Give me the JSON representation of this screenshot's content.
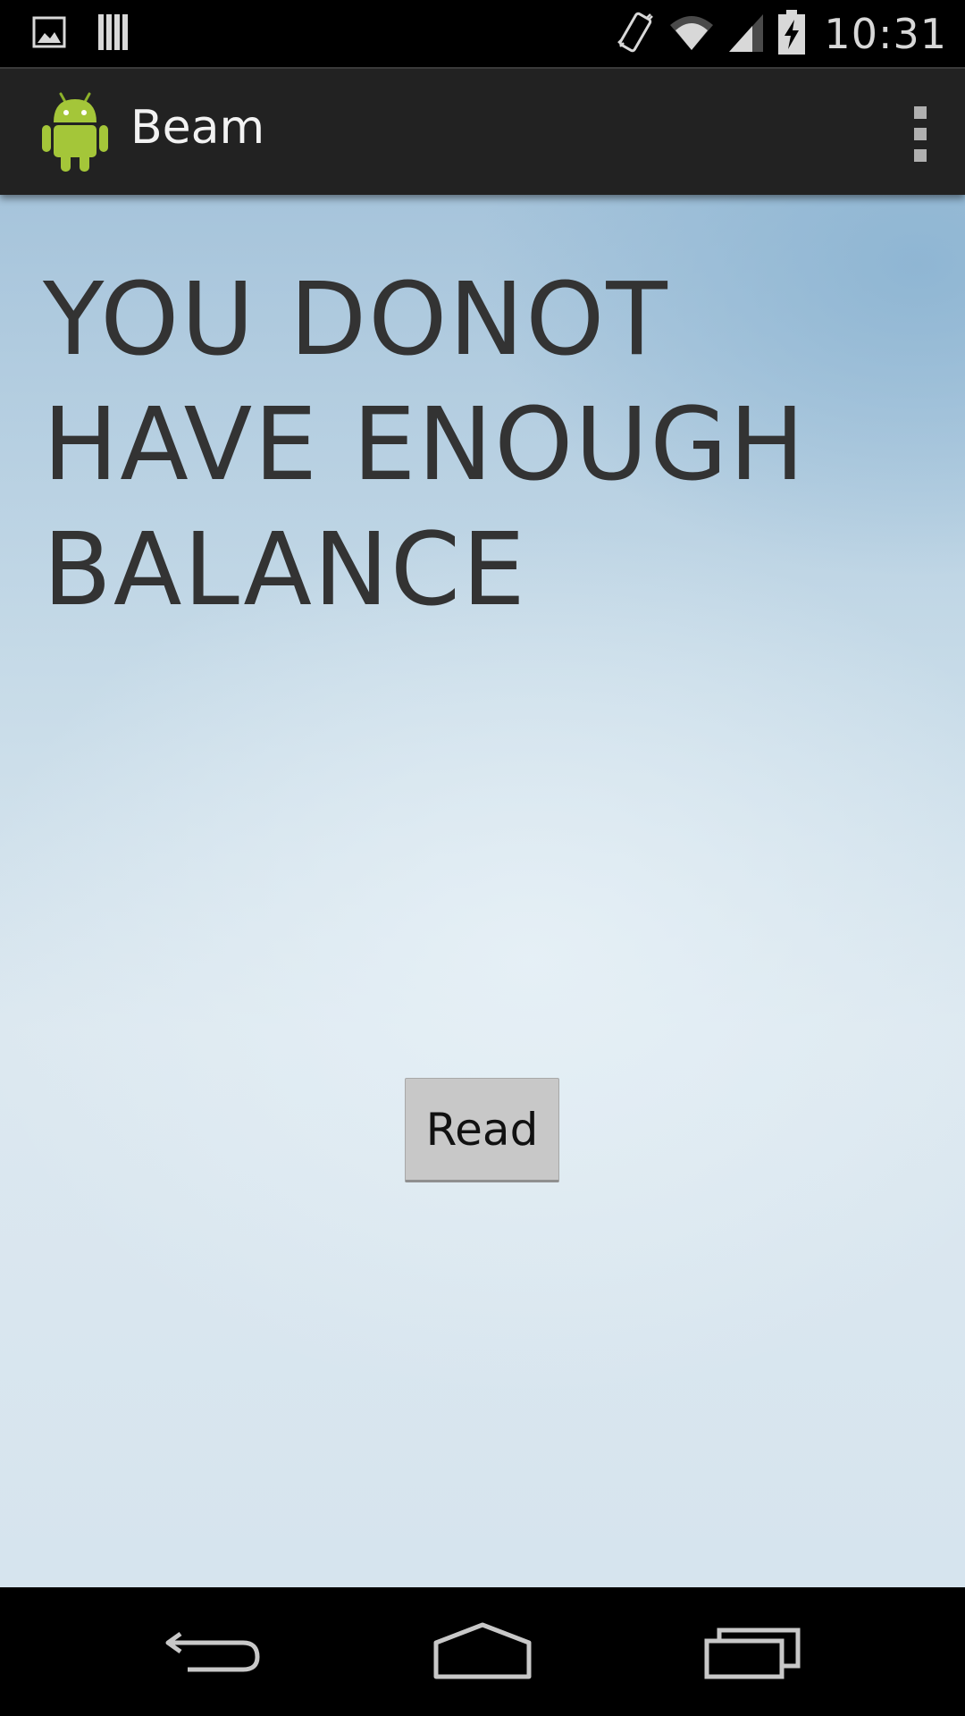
{
  "status_bar": {
    "time": "10:31",
    "left_icons": [
      "gallery-notification-icon",
      "barcode-notification-icon"
    ],
    "right_icons": [
      "vibrate-icon",
      "wifi-icon",
      "cell-signal-icon",
      "battery-charging-icon"
    ]
  },
  "action_bar": {
    "title": "Beam",
    "logo": "android-robot-icon",
    "overflow": "overflow-menu-icon"
  },
  "main": {
    "message": "YOU DONOT HAVE ENOUGH BALANCE",
    "read_button_label": "Read"
  },
  "nav_bar": {
    "buttons": [
      "back-icon",
      "home-icon",
      "recents-icon"
    ]
  },
  "colors": {
    "action_bar": "#222222",
    "text": "#333333",
    "button": "#c8c8c8",
    "android_green": "#a4c639"
  }
}
